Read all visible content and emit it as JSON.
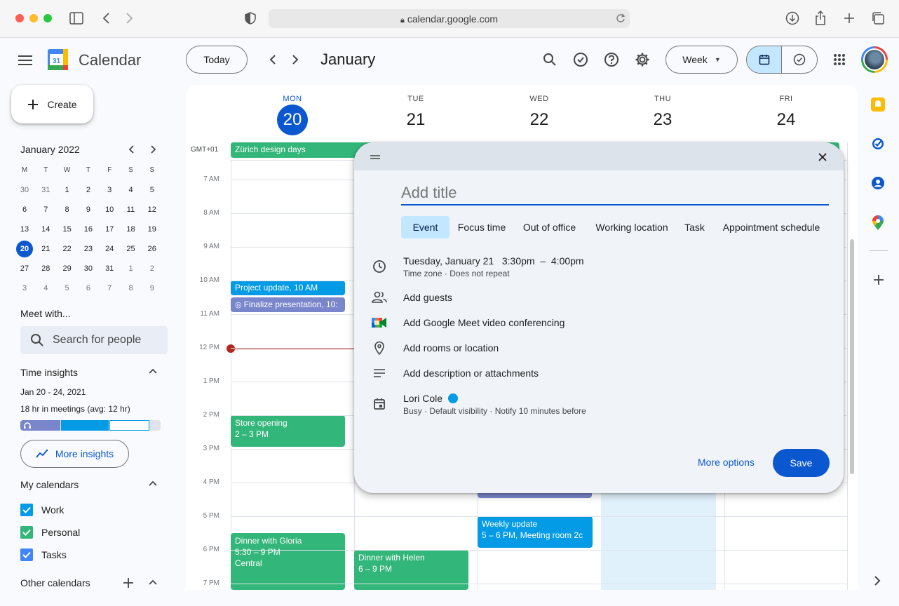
{
  "browser": {
    "url": "calendar.google.com"
  },
  "header": {
    "brand": "Calendar",
    "logo_day": "31",
    "today_label": "Today",
    "month_title": "January",
    "view_label": "Week"
  },
  "sidebar": {
    "create_label": "Create",
    "mini_calendar": {
      "title": "January 2022",
      "weekday_heads": [
        "M",
        "T",
        "W",
        "T",
        "F",
        "S",
        "S"
      ],
      "weeks": [
        [
          "30",
          "31",
          "1",
          "2",
          "3",
          "4",
          "5"
        ],
        [
          "6",
          "7",
          "8",
          "9",
          "10",
          "11",
          "12"
        ],
        [
          "13",
          "14",
          "15",
          "16",
          "17",
          "18",
          "19"
        ],
        [
          "20",
          "21",
          "22",
          "23",
          "24",
          "25",
          "26"
        ],
        [
          "27",
          "28",
          "29",
          "30",
          "31",
          "1",
          "2"
        ],
        [
          "3",
          "4",
          "5",
          "6",
          "7",
          "8",
          "9"
        ]
      ],
      "selected": "20"
    },
    "meet_with": {
      "title": "Meet with...",
      "search_placeholder": "Search for people"
    },
    "time_insights": {
      "title": "Time insights",
      "range": "Jan 20 - 24, 2021",
      "summary": "18 hr in meetings (avg: 12 hr)",
      "more_label": "More insights"
    },
    "my_calendars": {
      "title": "My calendars",
      "items": [
        {
          "label": "Work",
          "color": "#039be5"
        },
        {
          "label": "Personal",
          "color": "#33b679"
        },
        {
          "label": "Tasks",
          "color": "#4285f4"
        }
      ]
    },
    "other_calendars": {
      "title": "Other calendars"
    }
  },
  "week": {
    "timezone": "GMT+01",
    "days": [
      {
        "dow": "MON",
        "num": "20",
        "today": true
      },
      {
        "dow": "TUE",
        "num": "21"
      },
      {
        "dow": "WED",
        "num": "22"
      },
      {
        "dow": "THU",
        "num": "23"
      },
      {
        "dow": "FRI",
        "num": "24"
      }
    ],
    "hours": [
      "7 AM",
      "8 AM",
      "9 AM",
      "10 AM",
      "11 AM",
      "12 PM",
      "1 PM",
      "2 PM",
      "3 PM",
      "4 PM",
      "5 PM",
      "6 PM",
      "7 PM"
    ],
    "allday_event": "Zürich design days",
    "events": {
      "project_update": "Project update, 10 AM",
      "finalize": "Finalize presentation, 10:",
      "store_opening_title": "Store opening",
      "store_opening_time": "2 – 3 PM",
      "dinner_gloria_title": "Dinner with Gloria",
      "dinner_gloria_time": "5:30 – 9 PM",
      "dinner_gloria_place": "Central",
      "dinner_helen_title": "Dinner with Helen",
      "dinner_helen_time": "6 – 9 PM",
      "weekly_update_title": "Weekly update",
      "weekly_update_detail": "5 – 6 PM, Meeting room 2c"
    }
  },
  "dialog": {
    "title_placeholder": "Add title",
    "types": [
      "Event",
      "Focus time",
      "Out of office",
      "Working location",
      "Task",
      "Appointment schedule"
    ],
    "active_type": "Event",
    "datetime": "Tuesday, January 21   3:30pm  –  4:00pm",
    "datetime_sub": "Time zone · Does not repeat",
    "add_guests": "Add guests",
    "meet": "Add Google Meet video conferencing",
    "location": "Add rooms or location",
    "description": "Add description or attachments",
    "owner": "Lori Cole",
    "owner_color": "#039be5",
    "owner_sub": "Busy · Default visibility · Notify 10 minutes before",
    "more_options": "More options",
    "save": "Save"
  }
}
